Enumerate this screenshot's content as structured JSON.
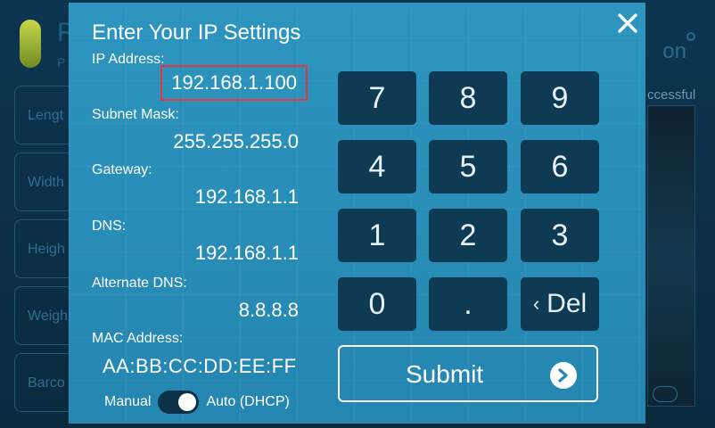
{
  "background": {
    "title_fragment": "R",
    "subtitle_fragment": "P",
    "fields": [
      "Lengt",
      "Width",
      "Heigh",
      "Weigh",
      "Barco"
    ],
    "logo_fragment": "on",
    "status_fragment": "ccessful"
  },
  "modal": {
    "title": "Enter Your IP Settings",
    "close_icon": "close-icon",
    "fields": {
      "ip_address": {
        "label": "IP Address:",
        "value": "192.168.1.100"
      },
      "subnet_mask": {
        "label": "Subnet Mask:",
        "value": "255.255.255.0"
      },
      "gateway": {
        "label": "Gateway:",
        "value": "192.168.1.1"
      },
      "dns": {
        "label": "DNS:",
        "value": "192.168.1.1"
      },
      "alternate_dns": {
        "label": "Alternate DNS:",
        "value": "8.8.8.8"
      },
      "mac_address": {
        "label": "MAC Address:",
        "value": "AA:BB:CC:DD:EE:FF"
      }
    },
    "mode_toggle": {
      "left_label": "Manual",
      "right_label": "Auto (DHCP)",
      "state": "auto"
    },
    "keypad": {
      "k7": "7",
      "k8": "8",
      "k9": "9",
      "k4": "4",
      "k5": "5",
      "k6": "6",
      "k1": "1",
      "k2": "2",
      "k3": "3",
      "k0": "0",
      "dot": ".",
      "del_glyph": "‹",
      "del_label": "Del"
    },
    "submit": {
      "label": "Submit",
      "icon": "chevron-right-circle-icon"
    }
  },
  "colors": {
    "modal_bg": "#2a90ba",
    "key_bg": "#0e3a53",
    "active_outline": "#e0383b"
  }
}
